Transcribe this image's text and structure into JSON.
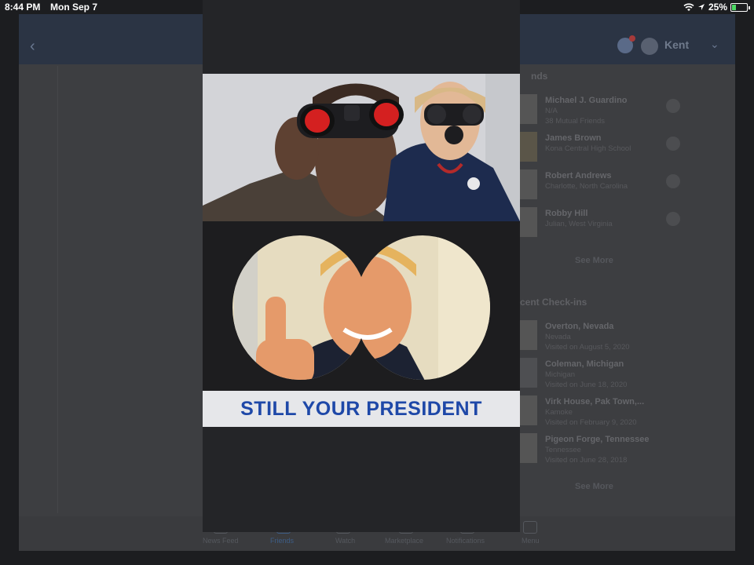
{
  "status_bar": {
    "time": "8:44 PM",
    "date": "Mon Sep 7",
    "battery": "25%",
    "battery_level": 0.25,
    "icons": [
      "wifi-icon",
      "location-arrow-icon",
      "battery-icon"
    ]
  },
  "header": {
    "username": "Kent"
  },
  "sidebar": {
    "friends_title": "nds",
    "friends": [
      {
        "name": "Michael J. Guardino",
        "line1": "N/A",
        "line2": "38 Mutual Friends"
      },
      {
        "name": "James Brown",
        "line1": "Kona Central High School",
        "line2": ""
      },
      {
        "name": "Robert Andrews",
        "line1": "Charlotte, North Carolina",
        "line2": ""
      },
      {
        "name": "Robby Hill",
        "line1": "Julian, West Virginia",
        "line2": ""
      }
    ],
    "see_more_1": "See More",
    "checkins_title": "cent Check-ins",
    "checkins": [
      {
        "name": "Overton, Nevada",
        "line1": "Nevada",
        "line2": "Visited on August 5, 2020"
      },
      {
        "name": "Coleman, Michigan",
        "line1": "Michigan",
        "line2": "Visited on June 18, 2020"
      },
      {
        "name": "Virk House, Pak Town,...",
        "line1": "Kamoke",
        "line2": "Visited on February 9, 2020"
      },
      {
        "name": "Pigeon Forge, Tennessee",
        "line1": "Tennessee",
        "line2": "Visited on June 28, 2018"
      }
    ],
    "see_more_2": "See More"
  },
  "bottom_nav": {
    "items": [
      "News Feed",
      "Friends",
      "Watch",
      "Marketplace",
      "Notifications",
      "Menu"
    ]
  },
  "photo": {
    "caption": "STILL YOUR PRESIDENT"
  },
  "colors": {
    "caption_text": "#1e48a8",
    "lens_red": "#d42020",
    "viewer_bg": "#242528"
  }
}
